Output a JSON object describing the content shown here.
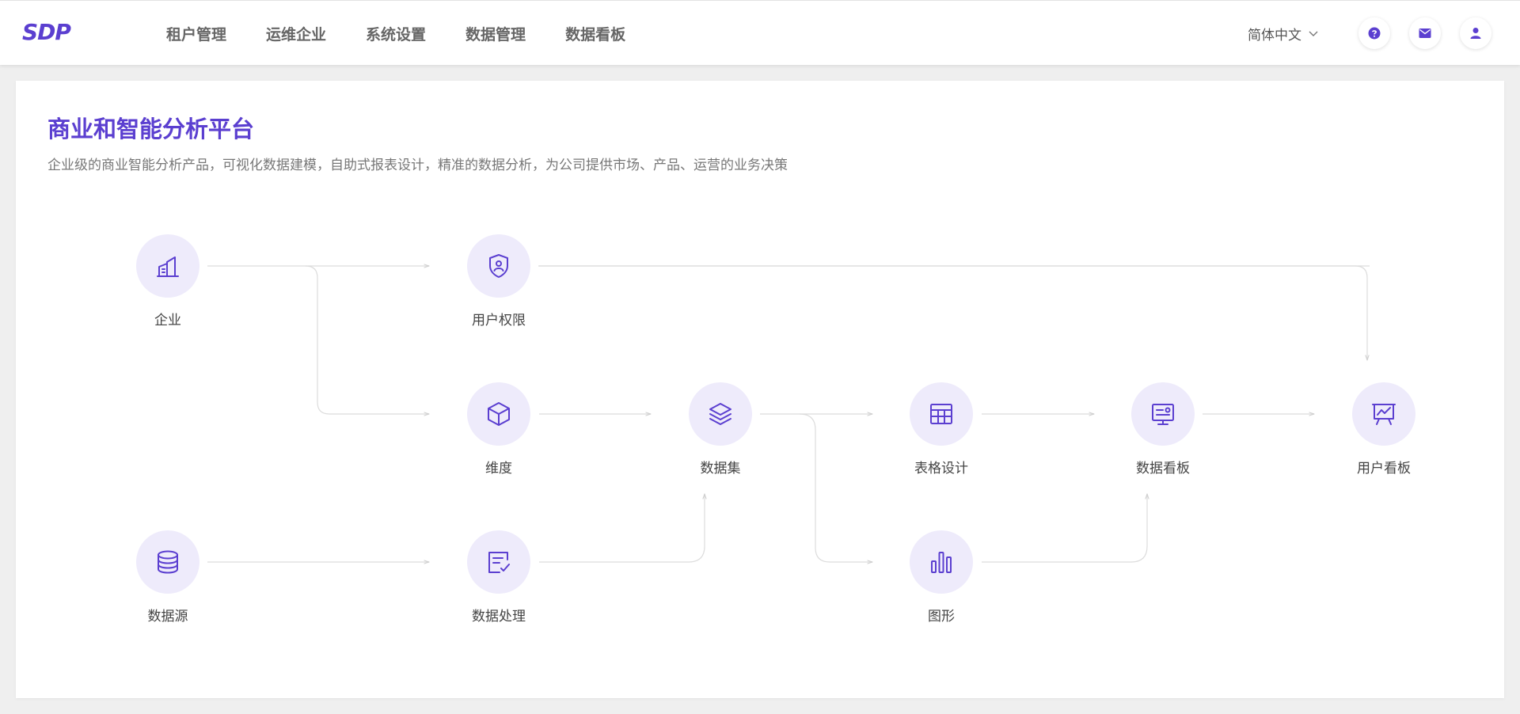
{
  "app": {
    "logo_text": "SDP"
  },
  "nav": {
    "items": [
      "租户管理",
      "运维企业",
      "系统设置",
      "数据管理",
      "数据看板"
    ]
  },
  "toolbar": {
    "language": "简体中文",
    "help_icon": "question-circle-icon",
    "mail_icon": "mail-icon",
    "user_icon": "user-icon"
  },
  "colors": {
    "accent": "#5b3fd0",
    "icon_bg": "#eeebfb",
    "line": "#dcdcdc"
  },
  "main": {
    "title": "商业和智能分析平台",
    "subtitle": "企业级的商业智能分析产品，可视化数据建模，自助式报表设计，精准的数据分析，为公司提供市场、产品、运营的业务决策"
  },
  "flow": {
    "nodes": {
      "enterprise": {
        "label": "企业",
        "icon": "building-icon"
      },
      "user_permission": {
        "label": "用户权限",
        "icon": "shield-user-icon"
      },
      "dimension": {
        "label": "维度",
        "icon": "cube-icon"
      },
      "dataset": {
        "label": "数据集",
        "icon": "layers-icon"
      },
      "table_design": {
        "label": "表格设计",
        "icon": "table-icon"
      },
      "data_board": {
        "label": "数据看板",
        "icon": "monitor-icon"
      },
      "user_board": {
        "label": "用户看板",
        "icon": "presentation-chart-icon"
      },
      "data_source": {
        "label": "数据源",
        "icon": "database-icon"
      },
      "data_processing": {
        "label": "数据处理",
        "icon": "edit-check-icon"
      },
      "graph": {
        "label": "图形",
        "icon": "bar-chart-icon"
      }
    }
  }
}
